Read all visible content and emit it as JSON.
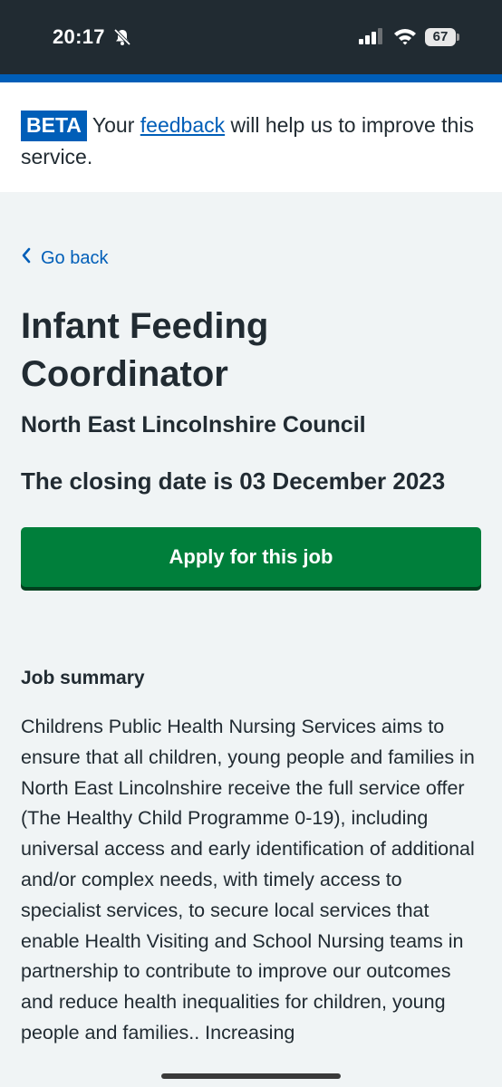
{
  "status_bar": {
    "time": "20:17",
    "battery": "67",
    "icons": [
      "bell-muted-icon",
      "signal-icon",
      "wifi-icon",
      "battery-icon"
    ]
  },
  "banner": {
    "tag": "BETA",
    "text_before": "Your",
    "link": "feedback",
    "text_after": "will help us to improve this service."
  },
  "nav": {
    "back_label": "Go back",
    "back_icon": "chevron-left-icon"
  },
  "job": {
    "title": "Infant Feeding Coordinator",
    "employer": "North East Lincolnshire Council",
    "closing": "The closing date is 03 December 2023",
    "apply_label": "Apply for this job",
    "summary_heading": "Job summary",
    "summary_text": "Childrens Public Health Nursing Services aims to ensure that all children, young people and families in North East Lincolnshire receive the full service offer (The Healthy Child Programme 0-19), including universal access and early identification of additional and/or complex needs, with timely access to specialist services, to secure local services that enable Health Visiting and School Nursing teams in partnership to contribute to improve our outcomes and reduce health inequalities for children, young people and families.. Increasing"
  },
  "colors": {
    "nhs_blue": "#005eb8",
    "button_green": "#007f3b",
    "text": "#212b32",
    "page_bg": "#f0f4f5"
  }
}
